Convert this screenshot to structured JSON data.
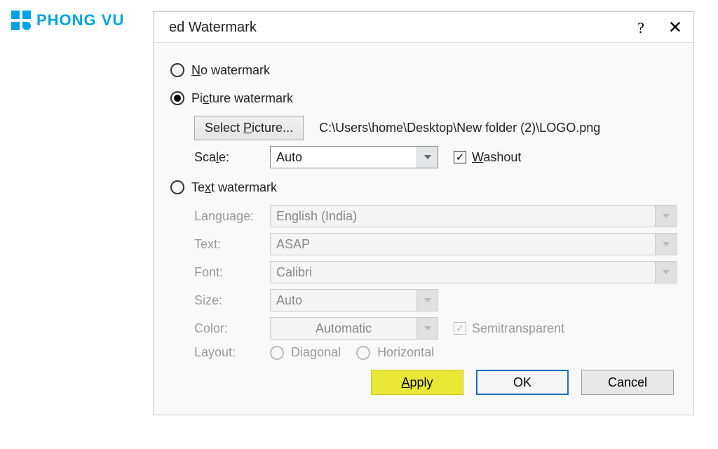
{
  "logo_text": "PHONG VU",
  "title": "ed Watermark",
  "help_symbol": "?",
  "close_symbol": "✕",
  "radio_no_watermark": {
    "prefix": "",
    "u": "N",
    "suffix": "o watermark"
  },
  "radio_picture": {
    "prefix": "Pi",
    "u": "c",
    "suffix": "ture watermark"
  },
  "radio_text": {
    "prefix": "Te",
    "u": "x",
    "suffix": "t watermark"
  },
  "select_picture": {
    "prefix": "Select ",
    "u": "P",
    "suffix": "icture..."
  },
  "picture_path": "C:\\Users\\home\\Desktop\\New folder (2)\\LOGO.png",
  "scale_label": {
    "prefix": "Sca",
    "u": "l",
    "suffix": "e:"
  },
  "scale_value": "Auto",
  "washout": {
    "u": "W",
    "suffix": "ashout"
  },
  "language_label": "Language:",
  "language_value": "English (India)",
  "text_label": "Text:",
  "text_value": "ASAP",
  "font_label": "Font:",
  "font_value": "Calibri",
  "size_label": "Size:",
  "size_value": "Auto",
  "color_label": "Color:",
  "color_value": "Automatic",
  "semitransparent_label": "Semitransparent",
  "layout_label": "Layout:",
  "layout_diagonal": "Diagonal",
  "layout_horizontal": "Horizontal",
  "apply_btn": {
    "u": "A",
    "suffix": "pply"
  },
  "ok_btn": "OK",
  "cancel_btn": "Cancel"
}
